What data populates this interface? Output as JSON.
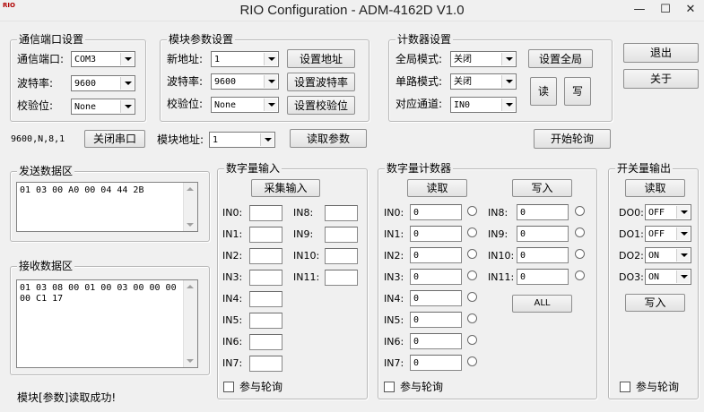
{
  "window": {
    "title": "RIO Configuration - ADM-4162D V1.0",
    "icon_top": "RIO",
    "minimize": "—",
    "maximize": "☐",
    "close": "✕"
  },
  "comm": {
    "legend": "通信端口设置",
    "port_label": "通信端口:",
    "port_value": "COM3",
    "baud_label": "波特率:",
    "baud_value": "9600",
    "parity_label": "校验位:",
    "parity_value": "None",
    "status": "9600,N,8,1",
    "close_port": "关闭串口"
  },
  "module": {
    "legend": "模块参数设置",
    "newaddr_label": "新地址:",
    "newaddr_value": "1",
    "set_addr": "设置地址",
    "baud_label": "波特率:",
    "baud_value": "9600",
    "set_baud": "设置波特率",
    "parity_label": "校验位:",
    "parity_value": "None",
    "set_parity": "设置校验位",
    "addr_label": "模块地址:",
    "addr_value": "1",
    "read_params": "读取参数"
  },
  "counter_settings": {
    "legend": "计数器设置",
    "global_label": "全局模式:",
    "global_value": "关闭",
    "set_global": "设置全局",
    "single_label": "单路模式:",
    "single_value": "关闭",
    "read": "读",
    "write": "写",
    "channel_label": "对应通道:",
    "channel_value": "IN0"
  },
  "right": {
    "exit": "退出",
    "about": "关于",
    "start_poll": "开始轮询"
  },
  "send": {
    "legend": "发送数据区",
    "content": "01 03 00 A0 00 04 44 2B"
  },
  "recv": {
    "legend": "接收数据区",
    "content": "01 03 08 00 01 00 03 00 00 00\n00 C1 17"
  },
  "status_msg": "模块[参数]读取成功!",
  "di": {
    "legend": "数字量输入",
    "collect": "采集输入",
    "left_labels": [
      "IN0:",
      "IN1:",
      "IN2:",
      "IN3:",
      "IN4:",
      "IN5:",
      "IN6:",
      "IN7:"
    ],
    "right_labels": [
      "IN8:",
      "IN9:",
      "IN10:",
      "IN11:"
    ],
    "poll": "参与轮询"
  },
  "dc": {
    "legend": "数字量计数器",
    "read": "读取",
    "write": "写入",
    "left_labels": [
      "IN0:",
      "IN1:",
      "IN2:",
      "IN3:",
      "IN4:",
      "IN5:",
      "IN6:",
      "IN7:"
    ],
    "left_values": [
      "0",
      "0",
      "0",
      "0",
      "0",
      "0",
      "0",
      "0"
    ],
    "right_labels": [
      "IN8:",
      "IN9:",
      "IN10:",
      "IN11:"
    ],
    "right_values": [
      "0",
      "0",
      "0",
      "0"
    ],
    "all": "ALL",
    "poll": "参与轮询"
  },
  "sw": {
    "legend": "开关量输出",
    "read": "读取",
    "labels": [
      "DO0:",
      "DO1:",
      "DO2:",
      "DO3:"
    ],
    "values": [
      "OFF",
      "OFF",
      "ON",
      "ON"
    ],
    "write": "写入",
    "poll": "参与轮询"
  }
}
